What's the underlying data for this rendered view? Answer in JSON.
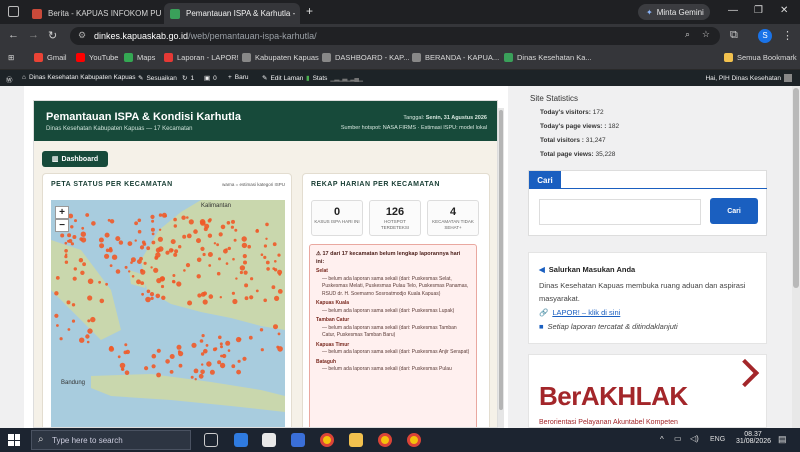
{
  "browser": {
    "tabs": [
      {
        "label": "Berita - KAPUAS INFOKOM PU..."
      },
      {
        "label": "Pemantauan ISPA & Karhutla -"
      }
    ],
    "gemini_label": "Minta Gemini",
    "url_site": "dinkes.kapuaskab.go.id",
    "url_path": "/web/pemantauan-ispa-karhutla/",
    "profile_initial": "S",
    "bookmarks": [
      "Gmail",
      "YouTube",
      "Maps",
      "Laporan - LAPOR!",
      "Kabupaten Kapuas",
      "DASHBOARD - KAP...",
      "BERANDA - KAPUA...",
      "Dinas Kesehatan Ka..."
    ],
    "all_bookmarks": "Semua Bookmark"
  },
  "wpbar": {
    "site": "Dinas Kesehatan Kabupaten Kapuas",
    "customize": "Sesuaikan",
    "updates": "1",
    "comments": "0",
    "new": "Baru",
    "edit": "Edit Laman",
    "stats": "Stats",
    "greeting": "Hai, PIH Dinas Kesehatan"
  },
  "app": {
    "title": "Pemantauan ISPA & Kondisi Karhutla",
    "subtitle": "Dinas Kesehatan Kabupaten Kapuas — 17 Kecamatan",
    "date_label": "Tanggal:",
    "date_value": "Senin, 31 Agustus 2026",
    "source": "Sumber hotspot: NASA FIRMS · Estimasi ISPU: model lokal",
    "dashboard_tab": "Dashboard",
    "map_title": "PETA STATUS PER KECAMATAN",
    "map_legend_note": "warna = estimasi kategori ISPU",
    "map_label_kalimantan": "Kalimantan",
    "map_label_bandung": "Bandung",
    "map_zoom_in": "+",
    "map_zoom_out": "−",
    "recap_title": "REKAP HARIAN PER KECAMATAN",
    "stats": [
      {
        "value": "0",
        "label": "KASUS ISPA HARI INI"
      },
      {
        "value": "126",
        "label": "HOTSPOT TERDETEKSI"
      },
      {
        "value": "4",
        "label": "KECAMATAN TIDAK SEHAT+"
      }
    ],
    "warning_header": "⚠ 17 dari 17 kecamatan belum lengkap laporannya hari ini:",
    "warnings": [
      {
        "kec": "Selat",
        "detail": "— belum ada laporan sama sekali (dari: Puskesmas Selat, Puskesmas Melati, Puskesmas Pulau Telo, Puskesmas Panamas, RSUD dr. H. Soemarno Sosroatmodjo Kuala Kapuas)"
      },
      {
        "kec": "Kapuas Kuala",
        "detail": "— belum ada laporan sama sekali (dari: Puskesmas Lupak)"
      },
      {
        "kec": "Tamban Catur",
        "detail": "— belum ada laporan sama sekali (dari: Puskesmas Tamban Catur, Puskesmas Tamban Baru)"
      },
      {
        "kec": "Kapuas Timur",
        "detail": "— belum ada laporan sama sekali (dari: Puskesmas Anjir Serapat)"
      },
      {
        "kec": "Bataguh",
        "detail": "— belum ada laporan sama sekali (dari: Puskesmas Pulau"
      }
    ]
  },
  "sidebar": {
    "stats_title": "Site Statistics",
    "rows": [
      {
        "label": "Today's visitors:",
        "value": "172"
      },
      {
        "label": "Today's page views: :",
        "value": "182"
      },
      {
        "label": "Total visitors :",
        "value": "31,247"
      },
      {
        "label": "Total page views:",
        "value": "35,228"
      }
    ],
    "search_title": "Cari",
    "search_button": "Cari",
    "feedback_title": "Salurkan Masukan Anda",
    "feedback_text": "Dinas Kesehatan Kapuas membuka ruang aduan dan aspirasi masyarakat.",
    "feedback_link": "LAPOR! – klik di sini",
    "feedback_note": "Setiap laporan tercatat & ditindaklanjuti",
    "banner_text": "BerAKHLAK",
    "banner_sub": "Berorientasi Pelayanan Akuntabel Kompeten"
  },
  "taskbar": {
    "search_placeholder": "Type here to search",
    "lang": "ENG",
    "time": "08.37",
    "date": "31/08/2026"
  },
  "colors": {
    "header_green": "#174a3a",
    "hotspot": "#f05a28",
    "accent_blue": "#1a5fc0",
    "banner_red": "#a3262a"
  }
}
